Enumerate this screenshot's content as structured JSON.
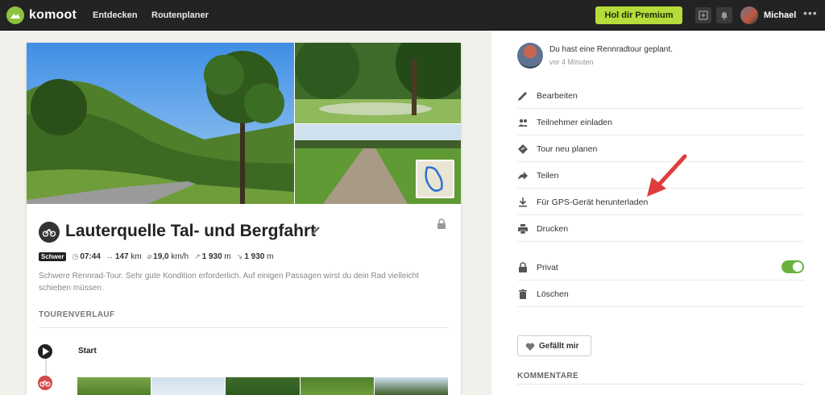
{
  "header": {
    "brand": "komoot",
    "nav": [
      "Entdecken",
      "Routenplaner"
    ],
    "premium_label": "Hol dir Premium",
    "user_name": "Michael",
    "more_label": "•••"
  },
  "tour": {
    "title": "Lauterquelle Tal- und Bergfahrt",
    "difficulty": "Schwer",
    "duration": "07:44",
    "distance": "147",
    "distance_unit": "km",
    "speed": "19,0",
    "speed_unit": "km/h",
    "uphill": "1 930",
    "uphill_unit": "m",
    "downhill": "1 930",
    "downhill_unit": "m",
    "description": "Schwere Rennrad-Tour. Sehr gute Kondition erforderlich. Auf einigen Passagen wirst du dein Rad vielleicht schieben müssen.",
    "route_heading": "TOURENVERLAUF",
    "start_label": "Start"
  },
  "panel": {
    "activity_text": "Du hast eine Rennradtour geplant.",
    "activity_time": "vor 4 Minuten",
    "menu": [
      {
        "label": "Bearbeiten",
        "icon": "pencil-icon"
      },
      {
        "label": "Teilnehmer einladen",
        "icon": "people-icon"
      },
      {
        "label": "Tour neu planen",
        "icon": "route-icon"
      },
      {
        "label": "Teilen",
        "icon": "share-icon"
      },
      {
        "label": "Für GPS-Gerät herunterladen",
        "icon": "download-icon"
      },
      {
        "label": "Drucken",
        "icon": "print-icon"
      },
      {
        "label": "Privat",
        "icon": "lock-icon",
        "toggle_on": true
      },
      {
        "label": "Löschen",
        "icon": "trash-icon"
      }
    ],
    "like_label": "Gefällt mir",
    "comments_heading": "KOMMENTARE"
  },
  "colors": {
    "accent_green": "#b5dc3a",
    "toggle_green": "#6ab23d",
    "annotation_red": "#e03c3c",
    "topbar": "#232323"
  }
}
